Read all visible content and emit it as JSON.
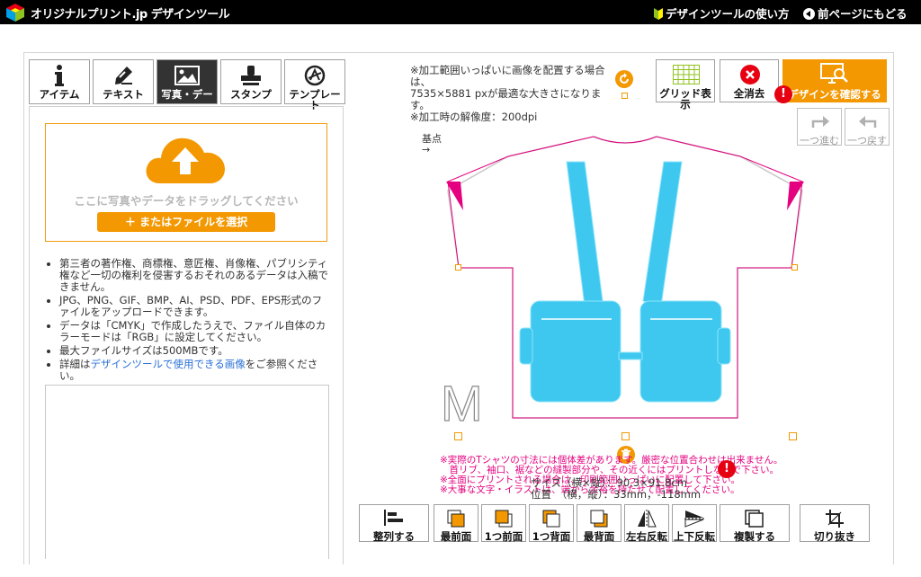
{
  "header": {
    "logo_text": "オリジナルプリント.jp デザインツール",
    "howto_link": "デザインツールの使い方",
    "back_link": "前ページにもどる"
  },
  "tabs": [
    {
      "label": "アイテム",
      "icon": "info-icon"
    },
    {
      "label": "テキスト",
      "icon": "pen-icon"
    },
    {
      "label": "写真・デー",
      "icon": "image-icon"
    },
    {
      "label": "スタンプ",
      "icon": "stamp-icon"
    },
    {
      "label": "テンプレー ト",
      "icon": "template-icon"
    }
  ],
  "upload": {
    "drop_text": "ここに写真やデータをドラッグしてください",
    "select_button": "＋ またはファイルを選択"
  },
  "notes": [
    "第三者の著作権、商標権、意匠権、肖像権、パブリシティ権など一切の権利を侵害するおそれのあるデータは入稿できません。",
    "JPG、PNG、GIF、BMP、AI、PSD、PDF、EPS形式のファイルをアップロードできます。",
    "データは「CMYK」で作成したうえで、ファイル自体のカラーモードは「RGB」に設定してください。",
    "最大ファイルサイズは500MBです。"
  ],
  "detail_note": {
    "prefix": "詳細は",
    "link": "デザインツールで使用できる画像",
    "suffix": "をご参照ください。"
  },
  "info": {
    "line1": "※加工範囲いっぱいに画像を配置する場合は、",
    "line2": "7535×5881 pxが最適な大きさになります。",
    "line3": "※加工時の解像度：200dpi"
  },
  "toolbar": {
    "grid": "グリッド表示",
    "clear": "全消去",
    "confirm": "デザインを確認する",
    "redo": "一つ進む",
    "undo": "一つ戻す"
  },
  "canvas": {
    "kiten": "基点",
    "size_letter": "M",
    "pink_notes": [
      "※実際のTシャツの寸法には個体差があります。厳密な位置合わせは出来ません。",
      "　首リブ、袖口、裾などの縫製部分や、その近くにはプリントしないで下さい。",
      "※全面にプリントされる場合は、印刷範囲いっぱいに配置して下さい。",
      "※大事な文字・イラストは、端から余裕を持たせて配置してください。"
    ],
    "size_label": "サイズ（横×縦）：90.3×91.8cm",
    "position_label": "位置　（横，縦）：33mm，-118mm"
  },
  "bottom_tools": [
    "整列する",
    "最前面",
    "1つ前面",
    "1つ背面",
    "最背面",
    "左右反転",
    "上下反転",
    "複製する",
    "切り抜き"
  ],
  "colors": {
    "accent": "#f39800",
    "alert": "#e60012",
    "pink": "#e4007f",
    "image_blue": "#3ec8f0"
  }
}
